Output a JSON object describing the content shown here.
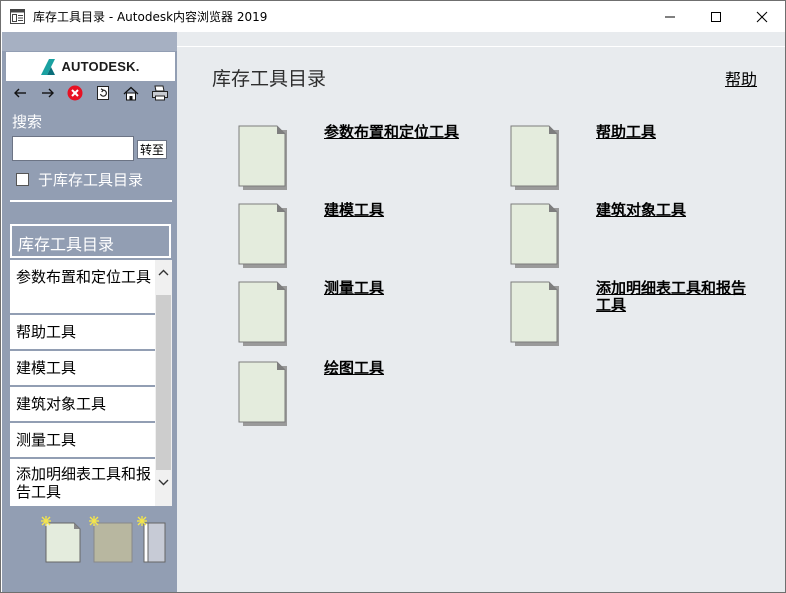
{
  "window": {
    "title": "库存工具目录 - Autodesk内容浏览器 2019"
  },
  "sidebar": {
    "logo_text": "AUTODESK.",
    "search_label": "搜索",
    "search_value": "",
    "go_label": "转至",
    "scope_label": "于库存工具目录",
    "scope_checked": false,
    "toc_title": "库存工具目录",
    "toc_items": [
      {
        "label": "参数布置和定位工具"
      },
      {
        "label": "帮助工具"
      },
      {
        "label": "建模工具"
      },
      {
        "label": "建筑对象工具"
      },
      {
        "label": "测量工具"
      },
      {
        "label": "添加明细表工具和报告工具"
      }
    ]
  },
  "main": {
    "title": "库存工具目录",
    "help_label": "帮助",
    "categories": [
      {
        "label": "参数布置和定位工具"
      },
      {
        "label": "帮助工具"
      },
      {
        "label": "建模工具"
      },
      {
        "label": "建筑对象工具"
      },
      {
        "label": "测量工具"
      },
      {
        "label": "添加明细表工具和报告工具"
      },
      {
        "label": "绘图工具"
      }
    ]
  },
  "colors": {
    "sidebar_bg": "#929eb3",
    "content_bg": "#e8ebee",
    "doc_fill": "#e4ecdd",
    "close_red": "#e81123"
  }
}
